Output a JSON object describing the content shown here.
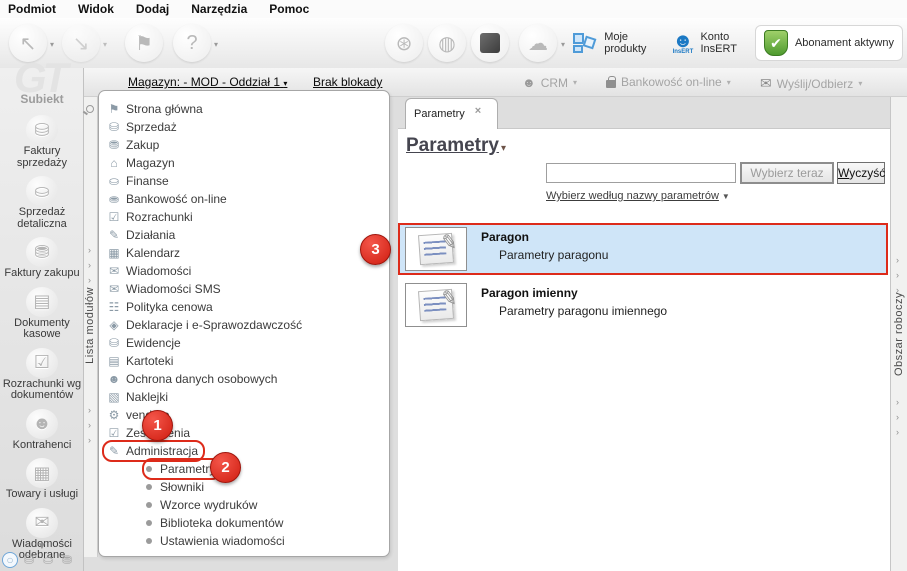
{
  "menu_bar": {
    "items": [
      {
        "label": "Podmiot"
      },
      {
        "label": "Widok"
      },
      {
        "label": "Dodaj"
      },
      {
        "label": "Narzędzia"
      },
      {
        "label": "Pomoc"
      }
    ]
  },
  "toolbar": {
    "back_glyph": "↖",
    "forward_glyph": "↘",
    "flag_glyph": "⚑",
    "help_glyph": "?",
    "sync_glyph": "⊛",
    "globe_glyph": "◍",
    "cloud_glyph": "☁",
    "caret": "▾",
    "my_products_label": "Moje\nprodukty",
    "account_label": "Konto\nInsERT",
    "account_badge": "InsERT",
    "person_glyph": "☻",
    "shield_check": "✔",
    "subscription_label": "Abonament aktywny"
  },
  "context_bar": {
    "magazyn_link": "Magazyn: - MOD - Oddział 1",
    "magazyn_caret": "▾",
    "lock_link": "Brak blokady",
    "crm_label": "CRM",
    "banking_label": "Bankowość on-line",
    "send_receive_label": "Wyślij/Odbierz",
    "caret": "▾",
    "person_glyph": "☻",
    "send_glyph": "✉"
  },
  "module_sidebar": {
    "watermark": "GT",
    "app_name": "Subiekt",
    "items": [
      {
        "label": "Faktury\nsprzedaży",
        "glyph": "⛁"
      },
      {
        "label": "Sprzedaż\ndetaliczna",
        "glyph": "⛀"
      },
      {
        "label": "Faktury zakupu",
        "glyph": "⛃"
      },
      {
        "label": "Dokumenty\nkasowe",
        "glyph": "▤"
      },
      {
        "label": "Rozrachunki wg\ndokumentów",
        "glyph": "☑"
      },
      {
        "label": "Kontrahenci",
        "glyph": "☻"
      },
      {
        "label": "Towary i usługi",
        "glyph": "▦"
      },
      {
        "label": "Wiadomości\nodebrane",
        "glyph": "✉"
      }
    ],
    "overflow_glyph": "▼",
    "mini_icons": [
      {
        "name": "current-module",
        "glyph": "○",
        "selected": true
      },
      {
        "name": "sales-mini",
        "glyph": "⛁",
        "selected": false
      },
      {
        "name": "retail-mini",
        "glyph": "⛀",
        "selected": false
      },
      {
        "name": "purchase-mini",
        "glyph": "⛃",
        "selected": false
      }
    ]
  },
  "lista_strip": {
    "label": "Lista modułów",
    "chevron": "›"
  },
  "tree": {
    "items": [
      {
        "label": "Strona główna",
        "glyph": "⚑",
        "sub": false,
        "outlined": false
      },
      {
        "label": "Sprzedaż",
        "glyph": "⛁",
        "sub": false,
        "outlined": false
      },
      {
        "label": "Zakup",
        "glyph": "⛃",
        "sub": false,
        "outlined": false
      },
      {
        "label": "Magazyn",
        "glyph": "⌂",
        "sub": false,
        "outlined": false
      },
      {
        "label": "Finanse",
        "glyph": "⛀",
        "sub": false,
        "outlined": false
      },
      {
        "label": "Bankowość on-line",
        "glyph": "⛂",
        "sub": false,
        "outlined": false
      },
      {
        "label": "Rozrachunki",
        "glyph": "☑",
        "sub": false,
        "outlined": false
      },
      {
        "label": "Działania",
        "glyph": "✎",
        "sub": false,
        "outlined": false
      },
      {
        "label": "Kalendarz",
        "glyph": "▦",
        "sub": false,
        "outlined": false
      },
      {
        "label": "Wiadomości",
        "glyph": "✉",
        "sub": false,
        "outlined": false
      },
      {
        "label": "Wiadomości SMS",
        "glyph": "✉",
        "sub": false,
        "outlined": false
      },
      {
        "label": "Polityka cenowa",
        "glyph": "☷",
        "sub": false,
        "outlined": false
      },
      {
        "label": "Deklaracje i e-Sprawozdawczość",
        "glyph": "◈",
        "sub": false,
        "outlined": false
      },
      {
        "label": "Ewidencje",
        "glyph": "⛁",
        "sub": false,
        "outlined": false
      },
      {
        "label": "Kartoteki",
        "glyph": "▤",
        "sub": false,
        "outlined": false
      },
      {
        "label": "Ochrona danych osobowych",
        "glyph": "☻",
        "sub": false,
        "outlined": false
      },
      {
        "label": "Naklejki",
        "glyph": "▧",
        "sub": false,
        "outlined": false
      },
      {
        "label": "vendero",
        "glyph": "⚙",
        "sub": false,
        "outlined": false
      },
      {
        "label": "Zestawienia",
        "glyph": "☑",
        "sub": false,
        "outlined": false
      },
      {
        "label": "Administracja",
        "glyph": "✎",
        "sub": false,
        "outlined": true
      },
      {
        "label": "Parametry",
        "glyph": "",
        "sub": true,
        "outlined": true
      },
      {
        "label": "Słowniki",
        "glyph": "",
        "sub": true,
        "outlined": false
      },
      {
        "label": "Wzorce wydruków",
        "glyph": "",
        "sub": true,
        "outlined": false
      },
      {
        "label": "Biblioteka dokumentów",
        "glyph": "",
        "sub": true,
        "outlined": false
      },
      {
        "label": "Ustawienia wiadomości",
        "glyph": "",
        "sub": true,
        "outlined": false
      }
    ]
  },
  "annotations": {
    "step1": "1",
    "step2": "2",
    "step3": "3"
  },
  "main": {
    "tab_label": "Parametry",
    "tab_close": "×",
    "title": "Parametry",
    "title_caret": "▾",
    "search_value": "",
    "choose_button": "Wybierz teraz",
    "clear_button": "Wyczyść",
    "filter_link": "Wybierz według nazwy parametrów",
    "filter_caret": "▼",
    "pen_glyph": "✎",
    "list": [
      {
        "title": "Paragon",
        "desc": "Parametry paragonu",
        "selected": true
      },
      {
        "title": "Paragon imienny",
        "desc": "Parametry paragonu imiennego",
        "selected": false
      }
    ]
  },
  "workspace_strip": {
    "label": "Obszar roboczy",
    "chevron": "›"
  },
  "colors": {
    "annotation_red": "#dd2b1a",
    "selection_blue": "#cfe5f8",
    "accent_blue": "#1c79c4",
    "shield_green": "#4e9a2e"
  }
}
